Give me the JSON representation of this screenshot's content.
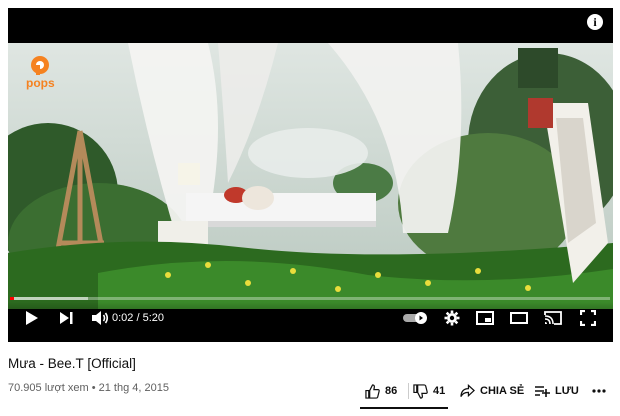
{
  "video": {
    "logo_text": "pops",
    "time_current": "0:02",
    "time_separator": "/",
    "time_total": "5:20",
    "progress_fraction": 0.006,
    "buffered_fraction": 0.13,
    "info_label": "i"
  },
  "details": {
    "title": "Mưa - Bee.T [Official]",
    "views": "70.905 lượt xem",
    "dot": "•",
    "date": "21 thg 4, 2015"
  },
  "actions": {
    "likes": "86",
    "dislikes": "41",
    "share_label": "CHIA SẺ",
    "save_label": "LƯU"
  },
  "colors": {
    "accent": "#ff0000",
    "pops_logo": "#f58220"
  }
}
